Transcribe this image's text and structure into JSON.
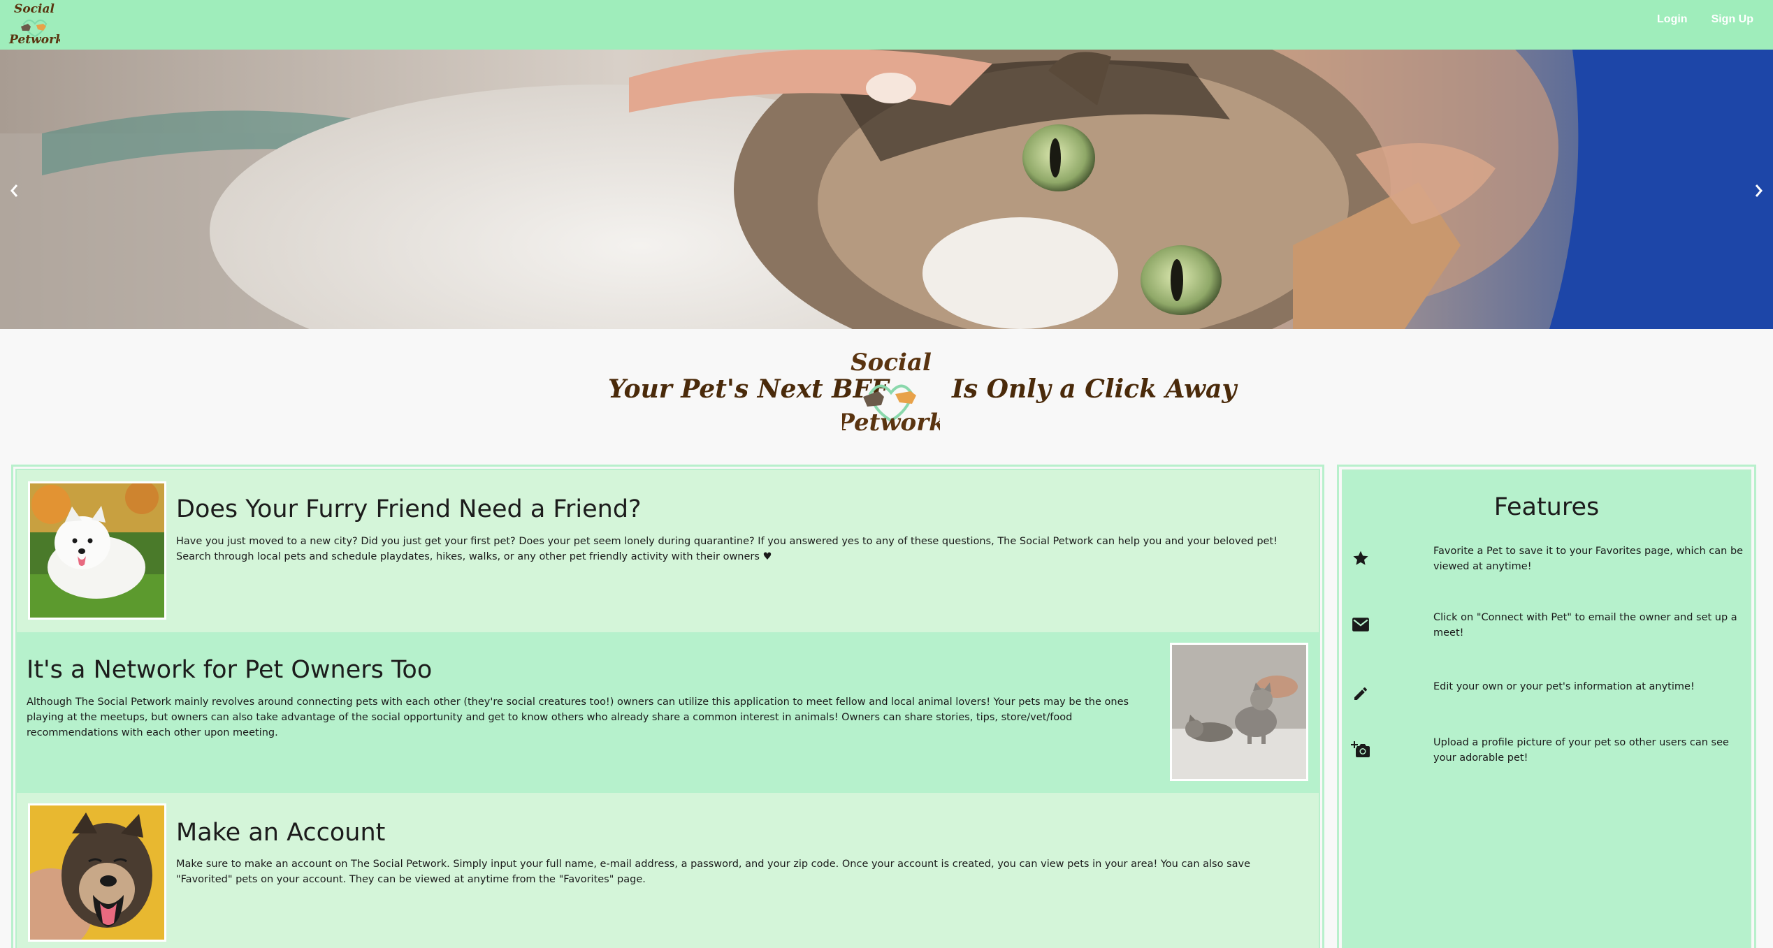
{
  "brand": {
    "line1": "Social",
    "line2": "Petwork"
  },
  "nav": {
    "login": "Login",
    "signup": "Sign Up"
  },
  "hero": {
    "prev_icon": "chevron-left-icon",
    "next_icon": "chevron-right-icon"
  },
  "tagline": {
    "left": "Your Pet's Next BFF",
    "right": "Is Only a Click Away"
  },
  "sections": [
    {
      "title": "Does Your Furry Friend Need a Friend?",
      "body": "Have you just moved to a new city? Did you just get your first pet? Does your pet seem lonely during quarantine? If you answered yes to any of these questions, The Social Petwork can help you and your beloved pet! Search through local pets and schedule playdates, hikes, walks, or any other pet friendly activity with their owners ♥"
    },
    {
      "title": "It's a Network for Pet Owners Too",
      "body": "Although The Social Petwork mainly revolves around connecting pets with each other (they're social creatures too!) owners can utilize this application to meet fellow and local animal lovers! Your pets may be the ones playing at the meetups, but owners can also take advantage of the social opportunity and get to know others who already share a common interest in animals! Owners can share stories, tips, store/vet/food recommendations with each other upon meeting."
    },
    {
      "title": "Make an Account",
      "body": "Make sure to make an account on The Social Petwork. Simply input your full name, e-mail address, a password, and your zip code. Once your account is created, you can view pets in your area! You can also save \"Favorited\" pets on your account. They can be viewed at anytime from the \"Favorites\" page."
    }
  ],
  "features": {
    "title": "Features",
    "items": [
      {
        "icon": "star-icon",
        "text": "Favorite a Pet to save it to your Favorites page, which can be viewed at anytime!"
      },
      {
        "icon": "mail-icon",
        "text": "Click on \"Connect with Pet\" to email the owner and set up a meet!"
      },
      {
        "icon": "pencil-icon",
        "text": "Edit your own or your pet's information at anytime!"
      },
      {
        "icon": "add-camera-icon",
        "text": "Upload a profile picture of your pet so other users can see your adorable pet!"
      }
    ]
  },
  "colors": {
    "nav": "#9fedbb",
    "section_light": "#d4f5d9",
    "section_mid": "#b6f1cc",
    "brand_brown": "#5a3410"
  }
}
